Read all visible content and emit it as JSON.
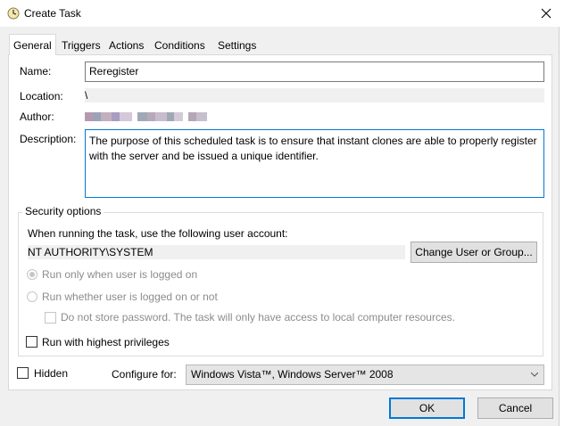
{
  "window": {
    "title": "Create Task",
    "icon": "task-scheduler-clock-icon"
  },
  "tabs": [
    {
      "label": "General",
      "active": true
    },
    {
      "label": "Triggers"
    },
    {
      "label": "Actions"
    },
    {
      "label": "Conditions"
    },
    {
      "label": "Settings"
    }
  ],
  "general": {
    "name_label": "Name:",
    "name_value": "Reregister",
    "location_label": "Location:",
    "location_value": "\\",
    "author_label": "Author:",
    "description_label": "Description:",
    "description_value": "The purpose of this scheduled task is to ensure that instant clones are able to properly register with the server and be issued a unique identifier."
  },
  "security": {
    "title": "Security options",
    "account_prompt": "When running the task, use the following user account:",
    "account_value": "NT AUTHORITY\\SYSTEM",
    "change_button": "Change User or Group...",
    "radio_logged_on": "Run only when user is logged on",
    "radio_whether": "Run whether user is logged on or not",
    "no_store_password": "Do not store password.  The task will only have access to local computer resources.",
    "highest_privileges": "Run with highest privileges"
  },
  "footer": {
    "hidden_label": "Hidden",
    "configure_label": "Configure for:",
    "configure_value": "Windows Vista™, Windows Server™ 2008",
    "ok_button": "OK",
    "cancel_button": "Cancel"
  },
  "colors": {
    "accent": "#0078d7",
    "dialog_bg": "#f0f0f0",
    "panel_bg": "#ffffff"
  }
}
